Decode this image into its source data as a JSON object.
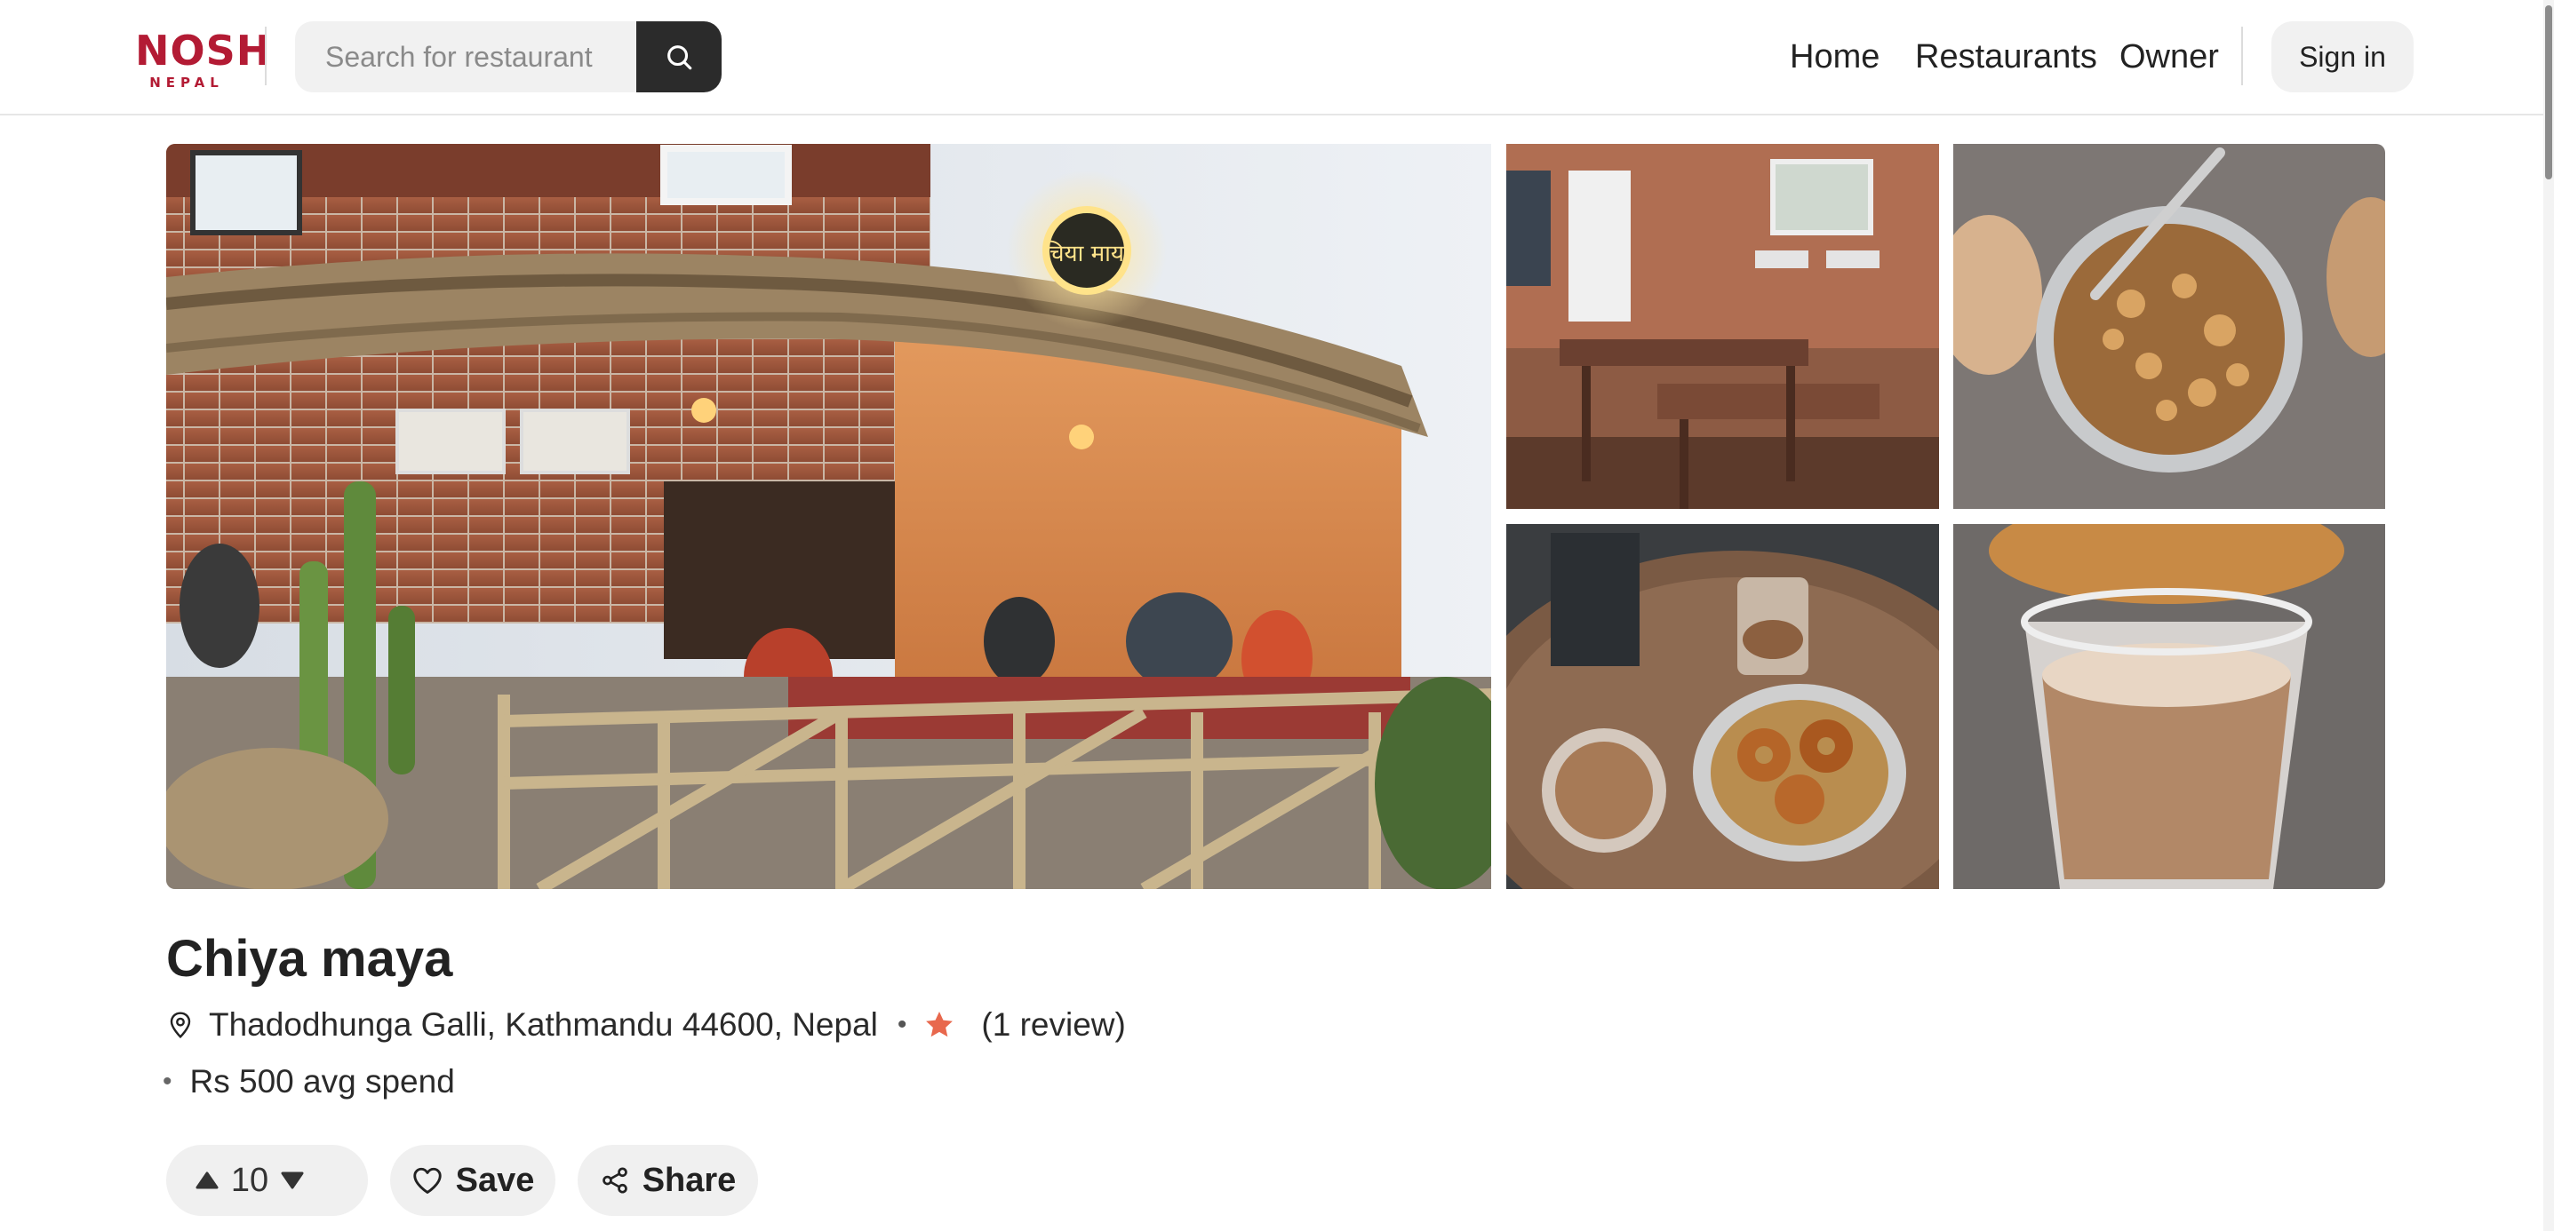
{
  "header": {
    "logo_text": "NOSH",
    "logo_subtext": "NEPAL",
    "search_placeholder": "Search for restaurant",
    "nav": [
      {
        "label": "Home"
      },
      {
        "label": "Restaurants"
      },
      {
        "label": "Owner"
      }
    ],
    "signin_label": "Sign in"
  },
  "colors": {
    "brand": "#b31b34",
    "star": "#e8684d",
    "dark_button": "#2b2b2b",
    "pill_background": "#f0f0f0"
  },
  "restaurant": {
    "name": "Chiya maya",
    "address": "Thadodhunga Galli, Kathmandu 44600, Nepal",
    "separator": "•",
    "reviews": "(1 review)",
    "avg_spend": "Rs 500 avg spend",
    "bullet": "•"
  },
  "gallery": {
    "sign_text": "चिया माया"
  },
  "actions": {
    "vote_count": "10",
    "save_label": "Save",
    "share_label": "Share"
  }
}
